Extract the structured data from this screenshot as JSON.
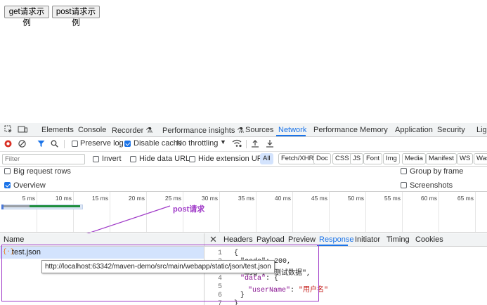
{
  "page": {
    "get_button": "get请求示例",
    "post_button": "post请求示例"
  },
  "devtools": {
    "tabs": [
      "Elements",
      "Console",
      "Recorder",
      "Performance insights",
      "Sources",
      "Network",
      "Performance",
      "Memory",
      "Application",
      "Security",
      "Lig"
    ],
    "active_tab": "Network",
    "toolbar": {
      "preserve_log": "Preserve log",
      "disable_cache": "Disable cache",
      "throttling": "No throttling"
    },
    "filter": {
      "placeholder": "Filter",
      "invert": "Invert",
      "hide_data_urls": "Hide data URLs",
      "hide_extension_urls": "Hide extension URLs",
      "chips": [
        "All",
        "Fetch/XHR",
        "Doc",
        "CSS",
        "JS",
        "Font",
        "Img",
        "Media",
        "Manifest",
        "WS",
        "Was"
      ]
    },
    "options": {
      "big_request_rows": "Big request rows",
      "group_by_frame": "Group by frame",
      "overview": "Overview",
      "screenshots": "Screenshots"
    },
    "timeline_ticks": [
      "5 ms",
      "10 ms",
      "15 ms",
      "20 ms",
      "25 ms",
      "30 ms",
      "35 ms",
      "40 ms",
      "45 ms",
      "50 ms",
      "55 ms",
      "60 ms",
      "65 ms"
    ],
    "annotation": "post请求",
    "name_header": "Name",
    "request": {
      "name": "test.json",
      "url_tooltip": "http://localhost:63342/maven-demo/src/main/webapp/static/json/test.json"
    },
    "detail_tabs": [
      "Headers",
      "Payload",
      "Preview",
      "Response",
      "Initiator",
      "Timing",
      "Cookies"
    ],
    "active_detail_tab": "Response",
    "response_lines": {
      "n1": "1",
      "n2": "2",
      "n3": "3",
      "n4": "4",
      "n5": "5",
      "n6": "6",
      "n7": "7",
      "l1": "{",
      "l2": "\"code\": 200,",
      "l3": "\"msg\": \"测试数据\",",
      "l4_key": "\"data\"",
      "l4_rest": ": {",
      "l5_key": "\"userName\"",
      "l5_sep": ": ",
      "l5_val": "\"用户名\"",
      "l6": "}",
      "l7": "}"
    }
  },
  "colors": {
    "accent": "#1a73e8",
    "annotation": "#a03bc8",
    "record": "#d93025"
  }
}
